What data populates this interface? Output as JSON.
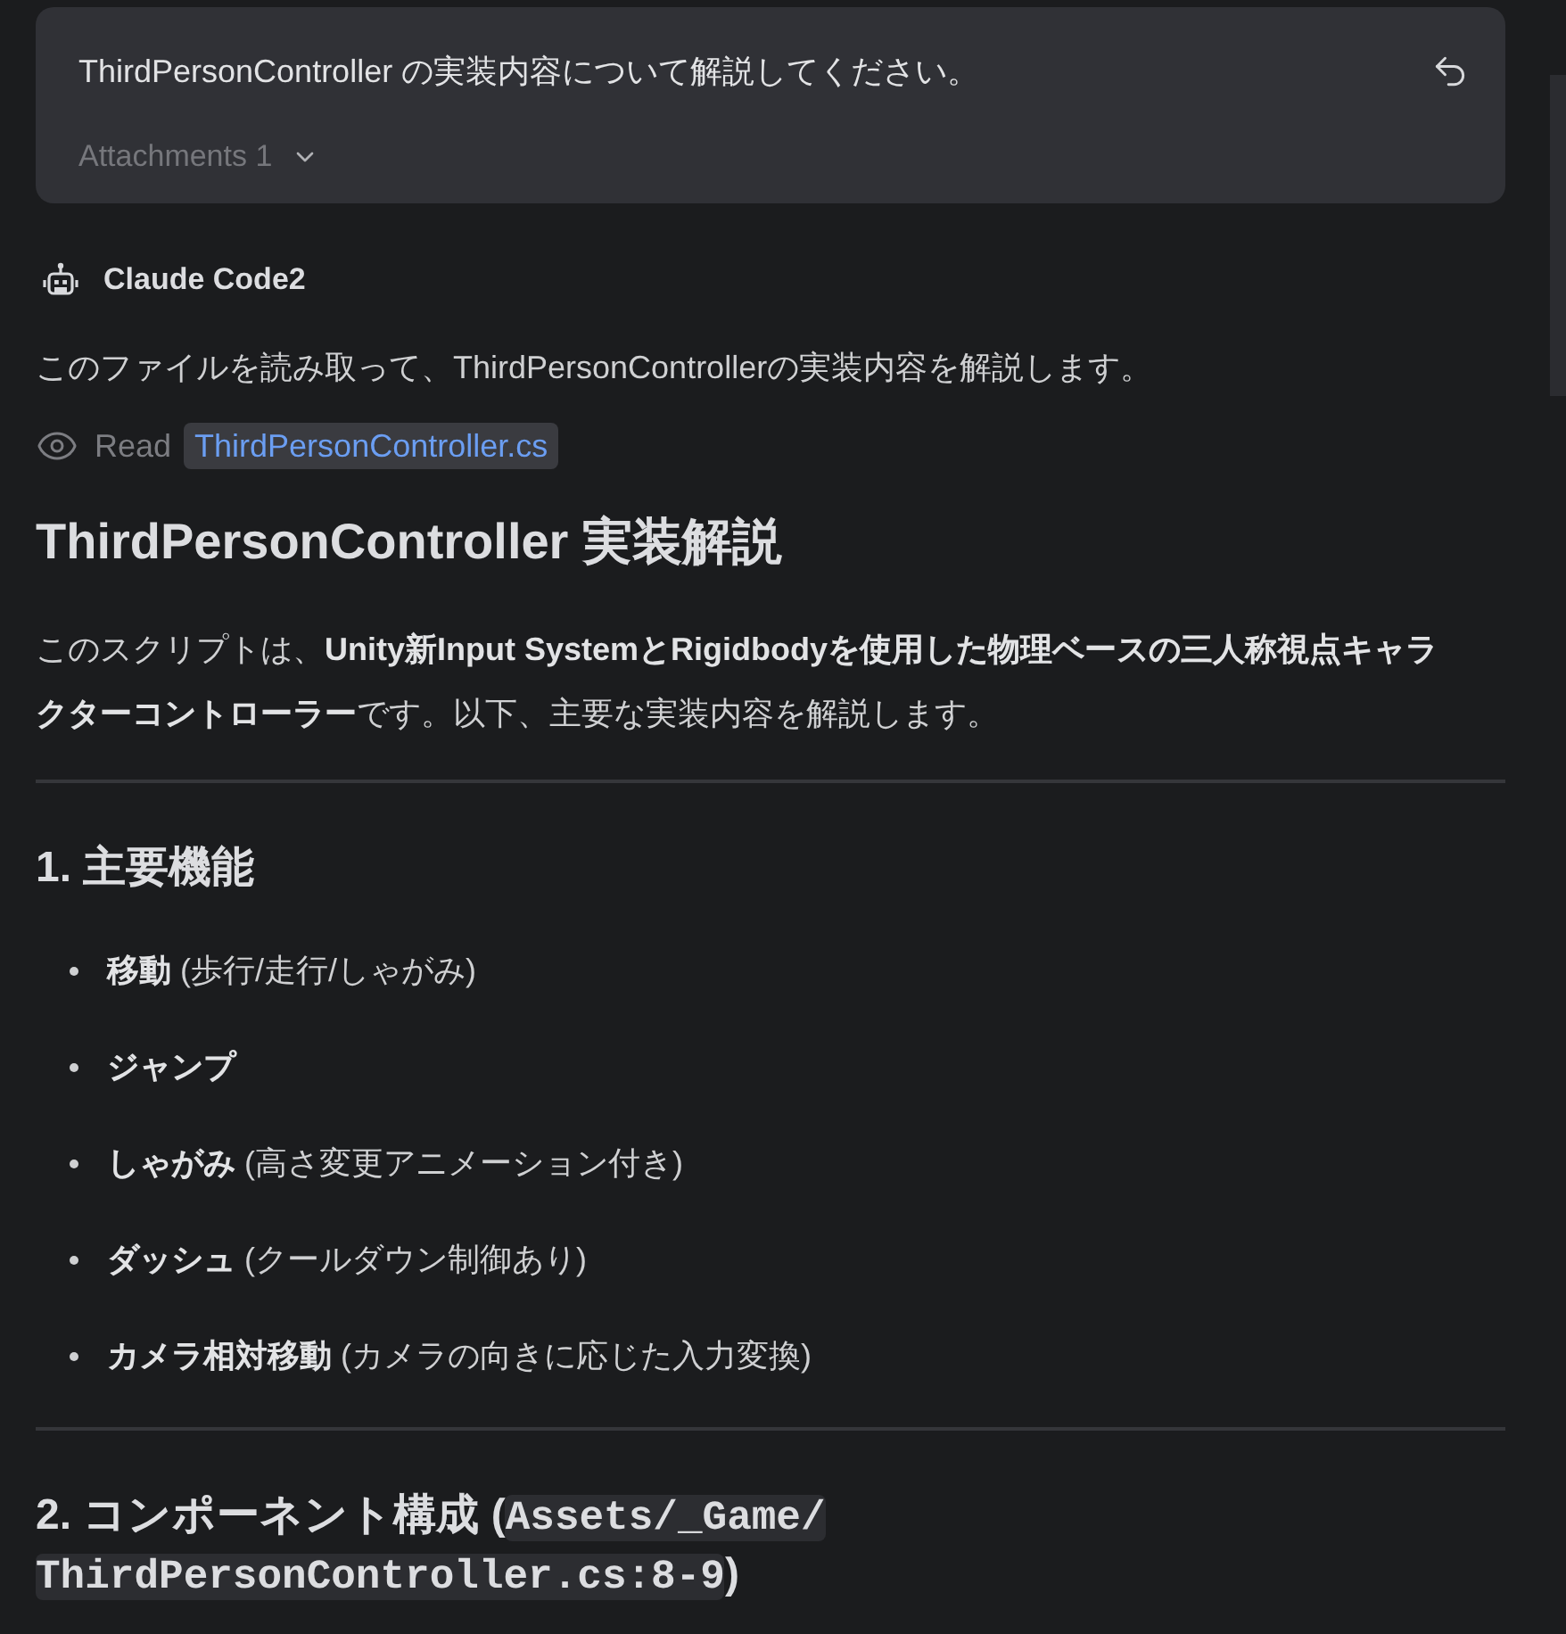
{
  "prompt_card": {
    "message": "ThirdPersonController の実装内容について解説してください。",
    "attachments": {
      "label": "Attachments 1",
      "expanded": false
    }
  },
  "response": {
    "author": "Claude Code2",
    "intro": "このファイルを読み取って、ThirdPersonControllerの実装内容を解説します。",
    "tool_call": {
      "action": "Read",
      "file": "ThirdPersonController.cs"
    },
    "title": "ThirdPersonController 実装解説",
    "summary": "このスクリプトは、**Unity新Input SystemとRigidbodyを使用した物理ベースの三人称視点キャラクターコントローラー**です。以下、主要な実装内容を解説します。",
    "sections": [
      {
        "heading": [
          {
            "kind": "text",
            "text": "1. 主要機能"
          }
        ],
        "items": [
          {
            "term": "移動",
            "note": "(歩行/走行/しゃがみ)"
          },
          {
            "term": "ジャンプ"
          },
          {
            "term": "しゃがみ",
            "note": "(高さ変更アニメーション付き)"
          },
          {
            "term": "ダッシュ",
            "note": "(クールダウン制御あり)"
          },
          {
            "term": "カメラ相対移動",
            "note": "(カメラの向きに応じた入力変換)"
          }
        ]
      },
      {
        "heading": [
          {
            "kind": "text",
            "text": "2. コンポーネント構成 ("
          },
          {
            "kind": "code",
            "text": "Assets/_Game/ThirdPersonController.cs:8-9"
          },
          {
            "kind": "text",
            "text": ")"
          }
        ]
      }
    ]
  }
}
